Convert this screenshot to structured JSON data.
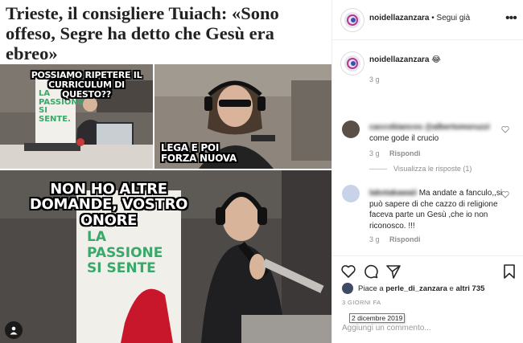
{
  "post_image": {
    "headline": "Trieste, il consigliere Tuiach: «Sono offeso, Segre ha detto che Gesù era ebreo»",
    "meme_top_left": "POSSIAMO RIPETERE IL CURRICULUM DI QUESTO??",
    "meme_top_right": "LEGA E POI FORZA NUOVA",
    "meme_bottom": "NON HO ALTRE DOMANDE, VOSTRO ONORE",
    "banner_small": "LA PASSIONE SI SENTE.",
    "banner_large": "LA PASSIONE SI SENTE"
  },
  "header": {
    "username": "noidellazanzara",
    "separator": "•",
    "follow_label": "Segui già",
    "more_icon": "more-icon"
  },
  "caption": {
    "username": "noidellazanzara",
    "text": "😂",
    "time": "3 g"
  },
  "comments": [
    {
      "username": "caccobiancos @albertomoruzzi",
      "text": "come gode il crucio",
      "time": "3 g",
      "reply_label": "Rispondi",
      "view_replies": "Visualizza le risposte (1)"
    },
    {
      "username": "lakotakawaii",
      "text": "Ma andate a fanculo,,si può sapere di che cazzo di religione faceva parte un Gesù ,che io non riconosco. !!!",
      "time": "3 g",
      "reply_label": "Rispondi"
    }
  ],
  "actions": {
    "likes_prefix": "Piace a",
    "likes_user": "perle_di_zanzara",
    "likes_and": "e",
    "likes_others": "altri 735",
    "days_ago": "3 GIORNI FA",
    "date_tooltip": "2 dicembre 2019",
    "comment_placeholder": "Aggiungi un commento..."
  },
  "colors": {
    "text": "#262626",
    "muted": "#8e8e8e",
    "border": "#efefef",
    "banner_green": "#3aa86a"
  }
}
